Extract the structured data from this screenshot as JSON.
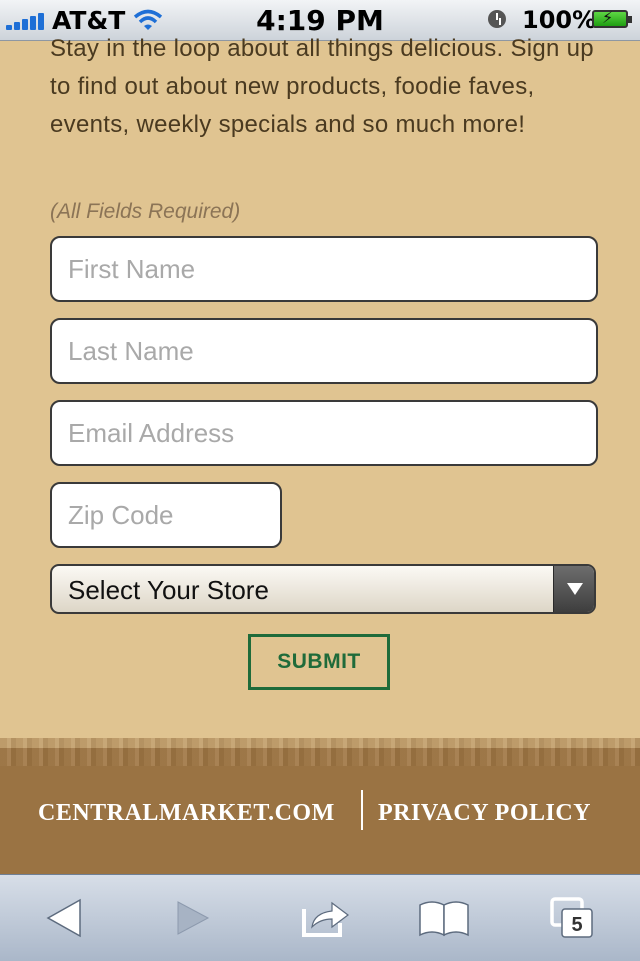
{
  "status_bar": {
    "carrier": "AT&T",
    "time": "4:19 PM",
    "battery": "100%"
  },
  "signup": {
    "intro": "Stay in the loop about all things delicious. Sign up to find out about new products, foodie faves, events, weekly specials and so much more!",
    "required_note": "(All Fields Required)",
    "first_name_placeholder": "First Name",
    "last_name_placeholder": "Last Name",
    "email_placeholder": "Email Address",
    "zip_placeholder": "Zip Code",
    "store_select": "Select Your Store",
    "submit_label": "SUBMIT"
  },
  "footer": {
    "site_link": "CENTRALMARKET.COM",
    "privacy_link": "PRIVACY POLICY"
  },
  "toolbar": {
    "tab_count": "5"
  },
  "colors": {
    "background": "#e0c491",
    "footer": "#9a7343",
    "submit_accent": "#1f6b3a"
  }
}
